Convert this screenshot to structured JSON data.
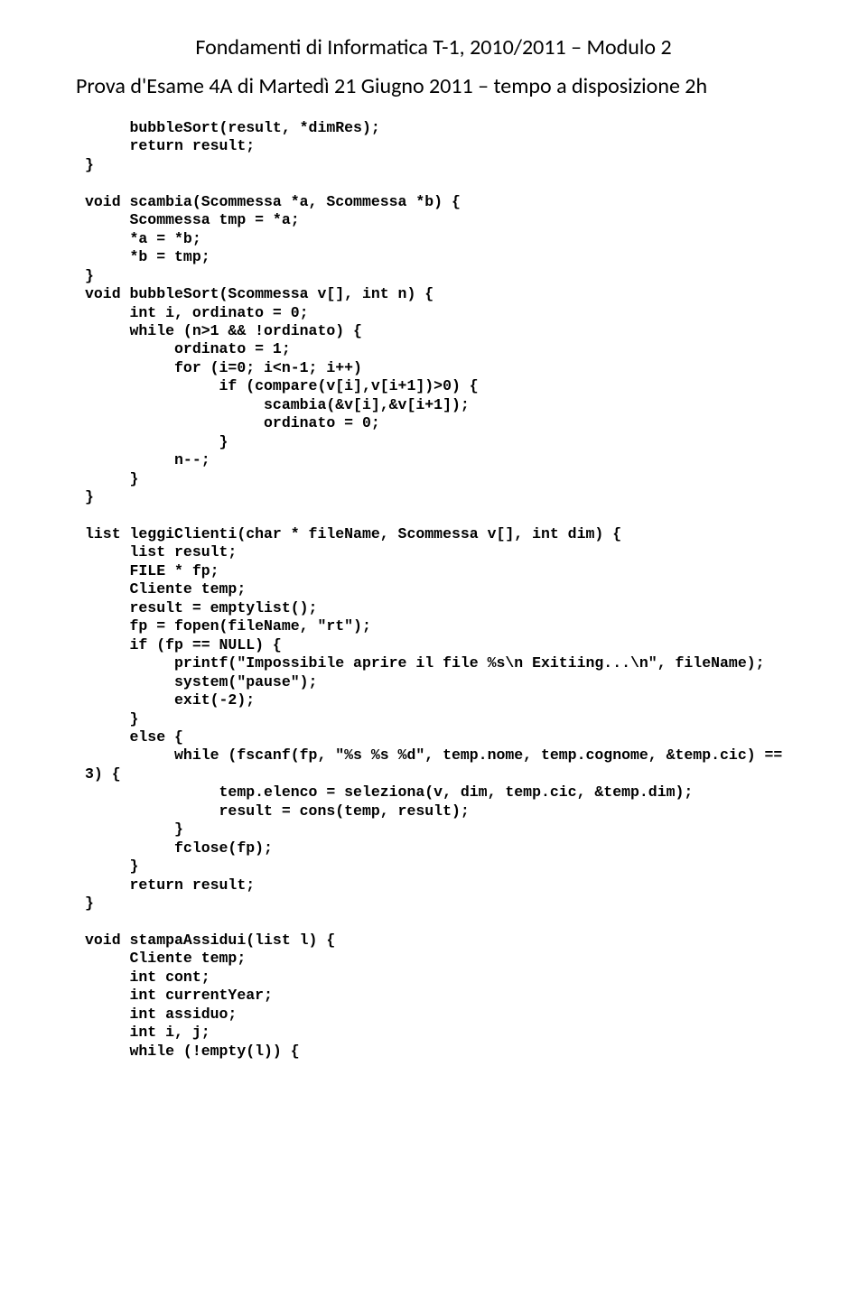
{
  "title": "Fondamenti di Informatica T-1, 2010/2011 – Modulo 2",
  "subtitle": "Prova d'Esame 4A di Martedì 21 Giugno 2011 – tempo a disposizione 2h",
  "code": "     bubbleSort(result, *dimRes);\n     return result;\n}\n\nvoid scambia(Scommessa *a, Scommessa *b) {\n     Scommessa tmp = *a;\n     *a = *b;\n     *b = tmp;\n}\nvoid bubbleSort(Scommessa v[], int n) {\n     int i, ordinato = 0;\n     while (n>1 && !ordinato) {\n          ordinato = 1;\n          for (i=0; i<n-1; i++)\n               if (compare(v[i],v[i+1])>0) {\n                    scambia(&v[i],&v[i+1]);\n                    ordinato = 0;\n               }\n          n--;\n     }\n}\n\nlist leggiClienti(char * fileName, Scommessa v[], int dim) {\n     list result;\n     FILE * fp;\n     Cliente temp;\n     result = emptylist();\n     fp = fopen(fileName, \"rt\");\n     if (fp == NULL) {\n          printf(\"Impossibile aprire il file %s\\n Exitiing...\\n\", fileName);\n          system(\"pause\");\n          exit(-2);\n     }\n     else {\n          while (fscanf(fp, \"%s %s %d\", temp.nome, temp.cognome, &temp.cic) ==\n3) {\n               temp.elenco = seleziona(v, dim, temp.cic, &temp.dim);\n               result = cons(temp, result);\n          }\n          fclose(fp);\n     }\n     return result;\n}\n\nvoid stampaAssidui(list l) {\n     Cliente temp;\n     int cont;\n     int currentYear;\n     int assiduo;\n     int i, j;\n     while (!empty(l)) {"
}
